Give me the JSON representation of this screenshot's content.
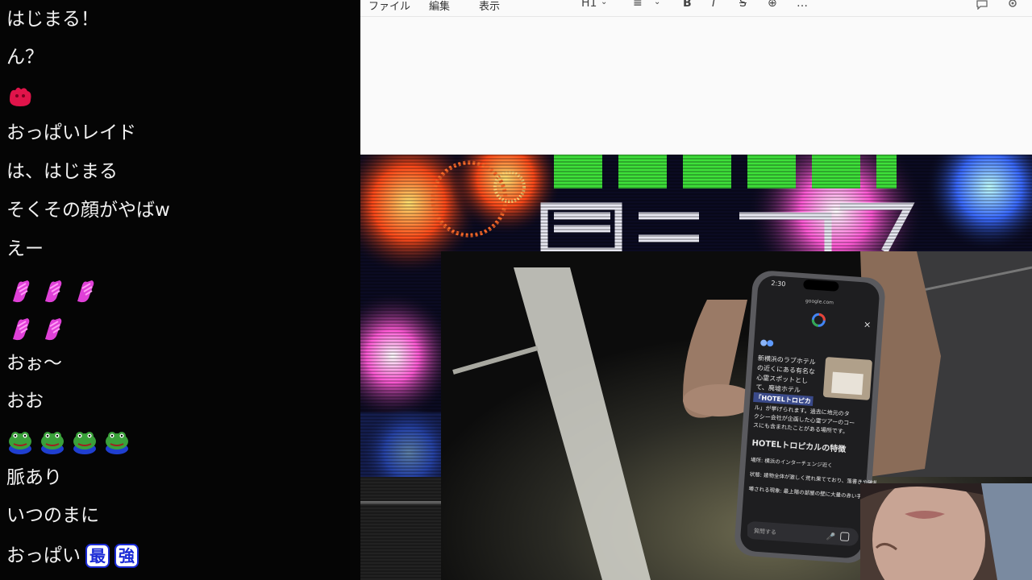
{
  "chat": {
    "messages": [
      {
        "text": "はじまる！"
      },
      {
        "text": "ん？"
      },
      {
        "text": ""
      },
      {
        "text": "おっぱいレイド"
      },
      {
        "text": "は、はじまる"
      },
      {
        "text": "そくその顔がやばw"
      },
      {
        "text": "えー"
      },
      {
        "text": ""
      },
      {
        "text": ""
      },
      {
        "text": "おぉ～"
      },
      {
        "text": "おお"
      },
      {
        "text": ""
      },
      {
        "text": "脈あり"
      },
      {
        "text": "いつのまに"
      },
      {
        "text": "おっぱい",
        "badges": [
          "最",
          "強"
        ]
      }
    ]
  },
  "editor": {
    "menu": [
      "ファイル",
      "編集",
      "表示"
    ],
    "toolbar": {
      "heading": "H1",
      "list": "≡",
      "bold": "B",
      "italic": "I",
      "strike": "S",
      "link": "⊕",
      "more": "…"
    }
  },
  "phone": {
    "time": "2:30",
    "url": "google.com",
    "para": [
      "新横浜のラブホテル",
      "の近くにある有名な",
      "心霊スポットとし",
      "て、廃墟ホテル",
      "「HOTELトロピカ",
      "ル」が挙げられます。過去に地元のタ",
      "クシー会社が企画した心霊ツアーのコー",
      "スにも含まれたことがある場所です。"
    ],
    "heading": "HOTELトロピカルの特徴",
    "bullets": [
      "場所: 横浜のインターチェンジ近く",
      "状態: 建物全体が激しく荒れ果てており、落書きや破損が見られる廃墟。",
      "噂される現象: 最上階の部屋の壁に大量の赤い手形が描かれているなど、怖ろしい目撃談があることから心霊ス"
    ],
    "input": "質問する"
  },
  "colors": {
    "chat_bg": "#050505",
    "editor_bg": "#fafafa",
    "banner_green": "#3ee03a"
  }
}
